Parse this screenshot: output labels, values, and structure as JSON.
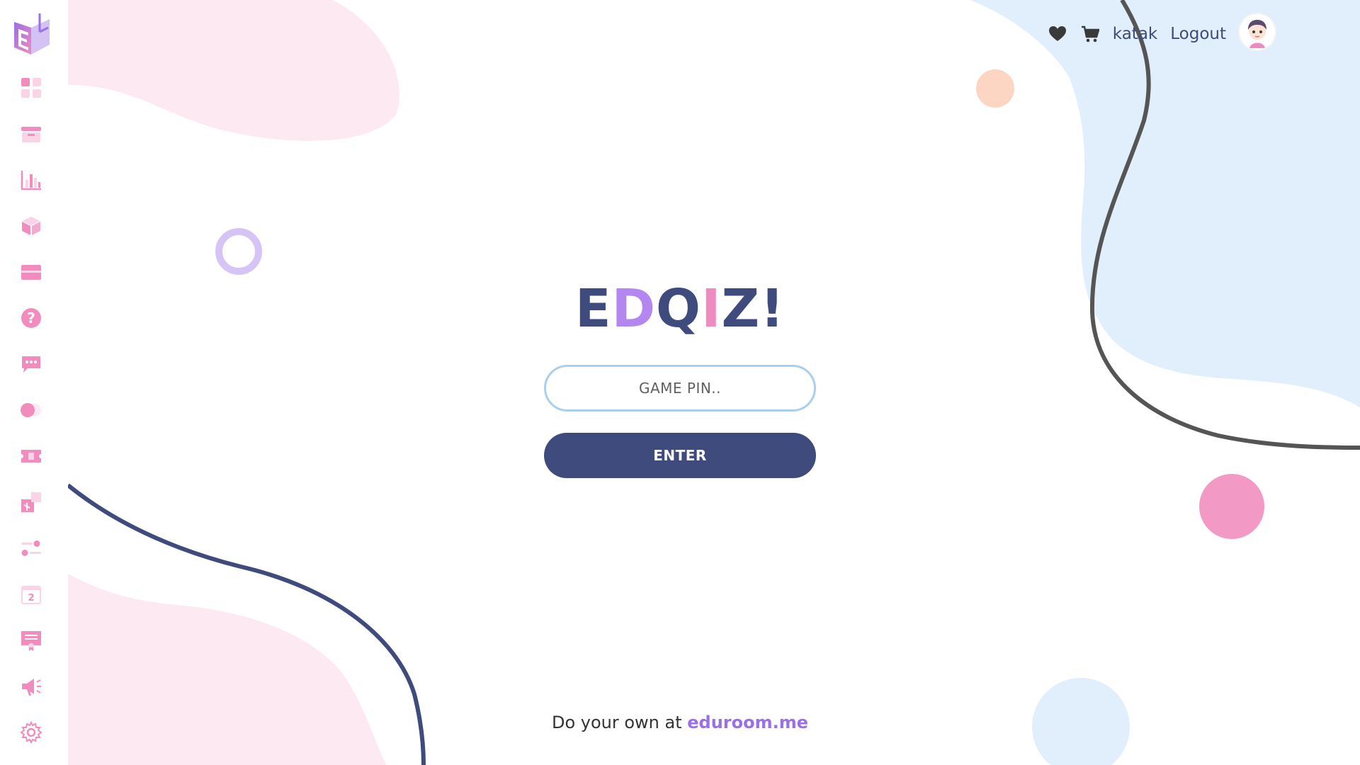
{
  "app": {
    "name": "EDQIZ!",
    "brand_letters": [
      {
        "char": "E",
        "color": "#3f4a7d"
      },
      {
        "char": "D",
        "color": "#b386f0"
      },
      {
        "char": "Q",
        "color": "#3f4a7d"
      },
      {
        "char": "I",
        "color": "#ef8bc0"
      },
      {
        "char": "Z",
        "color": "#3f4a7d"
      },
      {
        "char": "!",
        "color": "#3f4a7d"
      }
    ]
  },
  "sidebar": {
    "logo": "eduroom-logo",
    "items": [
      {
        "icon": "dashboard-icon"
      },
      {
        "icon": "inbox-icon"
      },
      {
        "icon": "bar-chart-icon"
      },
      {
        "icon": "cube-icon"
      },
      {
        "icon": "card-icon"
      },
      {
        "icon": "question-icon"
      },
      {
        "icon": "chat-icon"
      },
      {
        "icon": "toggle-icon"
      },
      {
        "icon": "ticket-icon"
      },
      {
        "icon": "puzzle-icon"
      },
      {
        "icon": "sliders-icon"
      },
      {
        "icon": "calendar-icon",
        "text": "2"
      },
      {
        "icon": "certificate-icon"
      },
      {
        "icon": "megaphone-icon"
      },
      {
        "icon": "settings-icon"
      }
    ]
  },
  "header": {
    "wishlist_icon": "heart-icon",
    "cart_icon": "cart-icon",
    "username": "katak",
    "logout_label": "Logout",
    "avatar": "user-avatar"
  },
  "join": {
    "pin_placeholder": "GAME PIN..",
    "pin_value": "",
    "enter_label": "ENTER"
  },
  "footer": {
    "prefix": "Do your own at",
    "link_text": "eduroom.me"
  },
  "colors": {
    "primary": "#3f4a7d",
    "accent_purple": "#9b6fe6",
    "accent_pink": "#ef8bc0",
    "sidebar_icon": "#f28cbf",
    "blob_blue": "#e1eefb",
    "blob_pink": "#fde9f1"
  }
}
